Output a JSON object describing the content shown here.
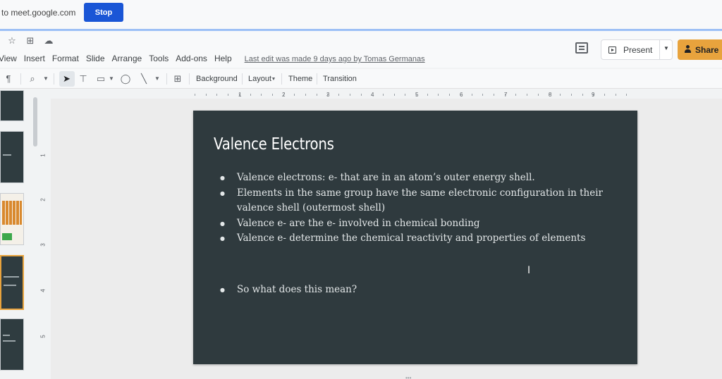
{
  "share_bar": {
    "text": "to meet.google.com",
    "stop_label": "Stop"
  },
  "header": {
    "icons": [
      "star-icon",
      "move-to-folder-icon",
      "cloud-status-icon"
    ],
    "menu": [
      "View",
      "Insert",
      "Format",
      "Slide",
      "Arrange",
      "Tools",
      "Add-ons",
      "Help"
    ],
    "last_edit": "Last edit was made 9 days ago by Tomas Germanas",
    "present_label": "Present",
    "share_label": "Share"
  },
  "toolbar": {
    "background_label": "Background",
    "layout_label": "Layout",
    "theme_label": "Theme",
    "transition_label": "Transition"
  },
  "ruler": {
    "numbers": [
      "1",
      "2",
      "3",
      "4",
      "5",
      "6",
      "7",
      "8",
      "9"
    ]
  },
  "vertical_ruler": {
    "numbers": [
      "1",
      "2",
      "3",
      "4",
      "5"
    ]
  },
  "slide": {
    "title": "Valence Electrons",
    "bullets": [
      "Valence electrons: e- that are in an atom’s outer energy shell.",
      "Elements in the same group have the same electronic configuration in their valence shell (outermost shell)",
      "Valence  e- are the e- involved in chemical bonding",
      "Valence e- determine the chemical reactivity and properties of elements",
      "So what does this mean?"
    ]
  },
  "colors": {
    "stop_button": "#1a56d6",
    "share_button": "#e8a33d",
    "slide_background": "#2f3a3e",
    "active_thumbnail_border": "#e8a33d"
  }
}
